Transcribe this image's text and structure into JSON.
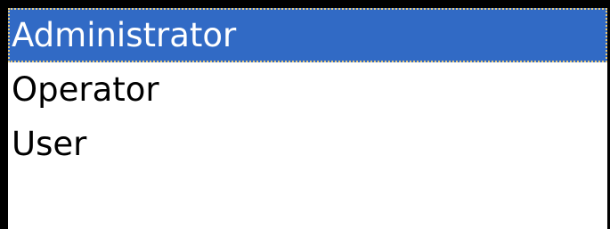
{
  "listbox": {
    "items": [
      {
        "label": "Administrator",
        "selected": true
      },
      {
        "label": "Operator",
        "selected": false
      },
      {
        "label": "User",
        "selected": false
      }
    ]
  },
  "colors": {
    "selection_background": "#316ac5",
    "selection_text": "#ffffff",
    "border": "#000000",
    "focus_outline": "#e8c878"
  }
}
